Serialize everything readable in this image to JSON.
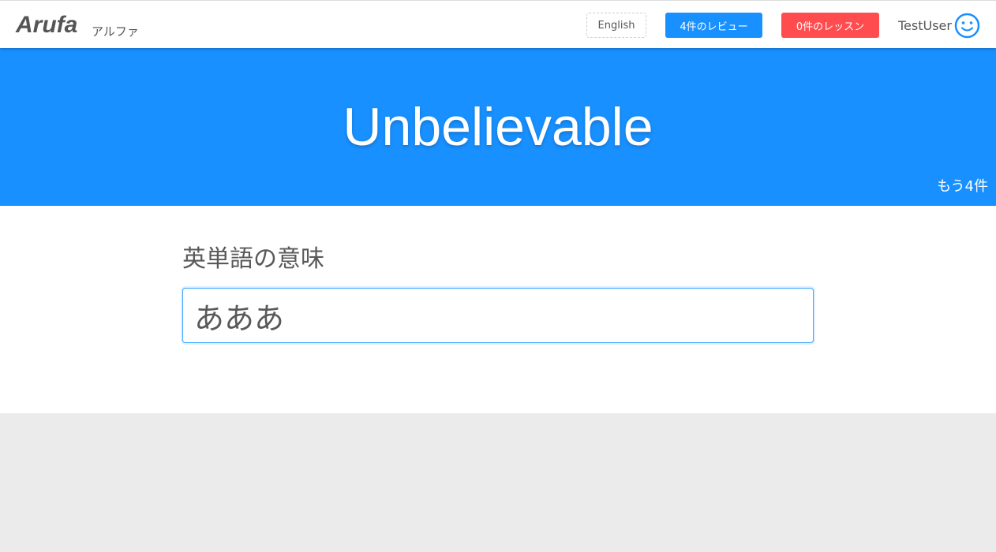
{
  "header": {
    "logo": "Arufa",
    "logo_sub": "アルファ",
    "language_button": "English",
    "review_button": "4件のレビュー",
    "lesson_button": "0件のレッスン",
    "username": "TestUser",
    "avatar_icon": "smiley-face-icon",
    "colors": {
      "review": "#1890ff",
      "lesson": "#ff4d4f"
    }
  },
  "hero": {
    "word": "Unbelievable",
    "remaining": "もう4件",
    "background": "#1890ff"
  },
  "quiz": {
    "prompt": "英単語の意味",
    "answer_value": "あああ"
  }
}
